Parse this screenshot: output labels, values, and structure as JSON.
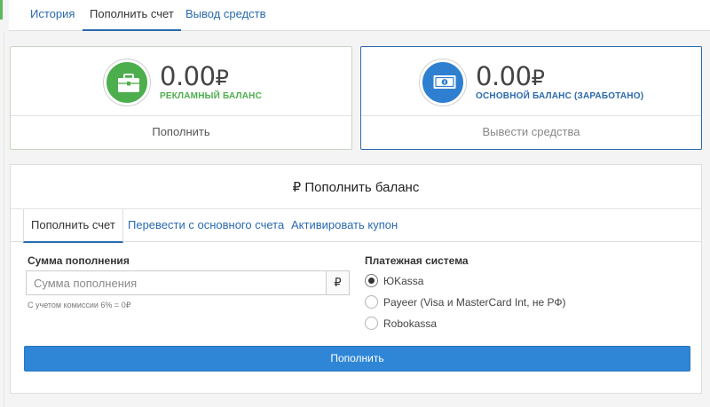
{
  "top_tabs": [
    {
      "label": "История",
      "active": false
    },
    {
      "label": "Пополнить счет",
      "active": true
    },
    {
      "label": "Вывод средств",
      "active": false
    }
  ],
  "balances": {
    "ads": {
      "amount": "0.00",
      "currency": "₽",
      "label": "РЕКЛАМНЫЙ БАЛАНС",
      "action": "Пополнить",
      "icon": "briefcase-icon",
      "color": "#4cae4c"
    },
    "main": {
      "amount": "0.00",
      "currency": "₽",
      "label": "ОСНОВНОЙ БАЛАНС (ЗАРАБОТАНО)",
      "action": "Вывести средства",
      "icon": "banknote-icon",
      "color": "#2f7fd1"
    }
  },
  "panel": {
    "title": "₽ Пополнить баланс",
    "tabs": [
      {
        "label": "Пополнить счет",
        "active": true
      },
      {
        "label": "Перевести с основного счета",
        "active": false
      },
      {
        "label": "Активировать купон",
        "active": false
      }
    ],
    "amount_label": "Сумма пополнения",
    "amount_value": "",
    "amount_placeholder": "Сумма пополнения",
    "currency_addon": "₽",
    "commission_hint": "С учетом комиссии 6% = 0₽",
    "payment_label": "Платежная система",
    "payment_options": [
      {
        "label": "ЮKassa",
        "checked": true
      },
      {
        "label": "Payeer (Visa и MasterCard Int, не РФ)",
        "checked": false
      },
      {
        "label": "Robokassa",
        "checked": false
      }
    ],
    "submit_label": "Пополнить"
  },
  "colors": {
    "accent": "#2a6aad",
    "button": "#2f86d6",
    "green": "#4cae4c"
  }
}
